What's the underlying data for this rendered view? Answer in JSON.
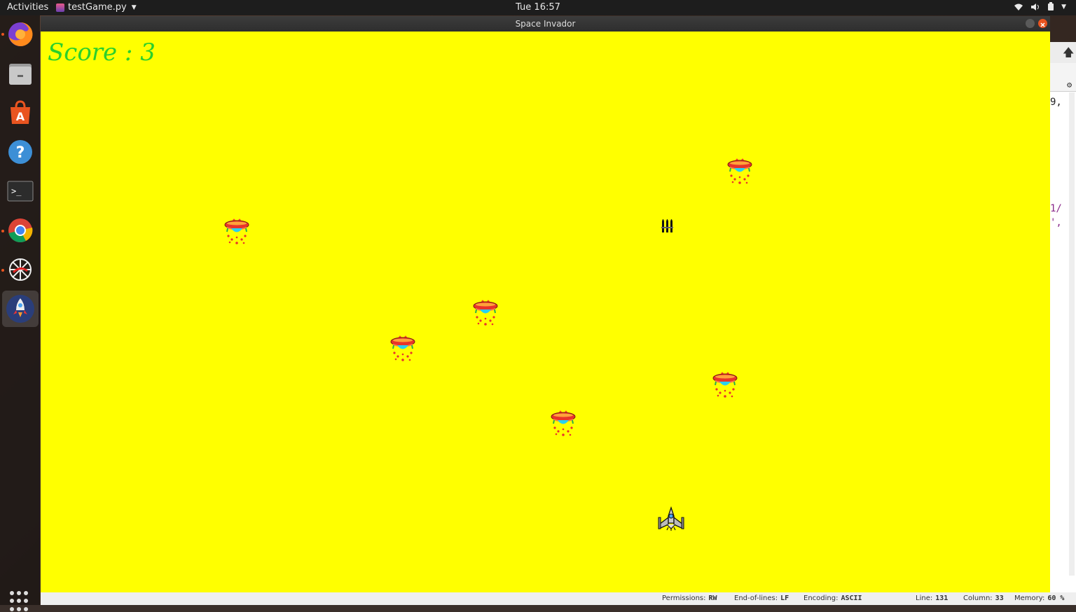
{
  "topbar": {
    "activities": "Activities",
    "app_name": "testGame.py",
    "clock": "Tue 16:57"
  },
  "window": {
    "title": "Space Invador"
  },
  "game": {
    "score_text": "Score : 3",
    "background_color": "#ffff00",
    "score_color": "#2bd02b",
    "enemy_count": 6,
    "icons": [
      "ufo-enemy-icon",
      "bullet-ammo-icon",
      "player-spaceship-icon"
    ]
  },
  "editor": {
    "line1": "9,",
    "line2": "1/",
    "line3": "',"
  },
  "statusbar": {
    "permissions_label": "Permissions:",
    "permissions_value": "RW",
    "eol_label": "End-of-lines:",
    "eol_value": "LF",
    "encoding_label": "Encoding:",
    "encoding_value": "ASCII",
    "line_label": "Line:",
    "line_value": "131",
    "column_label": "Column:",
    "column_value": "33",
    "memory_label": "Memory:",
    "memory_value": "60 %"
  },
  "dock": {
    "items": [
      "firefox-icon",
      "files-icon",
      "software-center-icon",
      "help-icon",
      "terminal-icon",
      "chrome-icon",
      "network-app-icon",
      "rocket-game-icon"
    ],
    "show_apps": "show-applications-icon"
  }
}
